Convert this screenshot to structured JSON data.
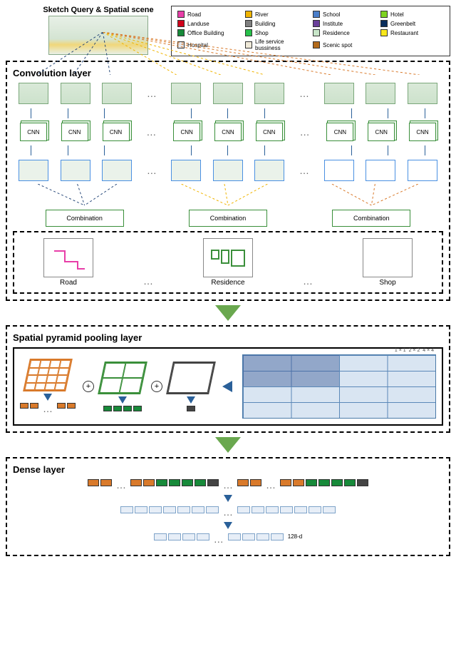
{
  "top": {
    "title": "Sketch Query & Spatial scene"
  },
  "legend": [
    {
      "label": "Road",
      "color": "#e83ea8"
    },
    {
      "label": "River",
      "color": "#f0b400"
    },
    {
      "label": "School",
      "color": "#4a7ec9"
    },
    {
      "label": "Hotel",
      "color": "#7ed321"
    },
    {
      "label": "Landuse",
      "color": "#d0021b"
    },
    {
      "label": "Building",
      "color": "#7f7f7f"
    },
    {
      "label": "Institute",
      "color": "#6a3f9a"
    },
    {
      "label": "Greenbelt",
      "color": "#0a2e5c"
    },
    {
      "label": "Office Building",
      "color": "#178a3a"
    },
    {
      "label": "Shop",
      "color": "#27c04a"
    },
    {
      "label": "Residence",
      "color": "#c8e6c9"
    },
    {
      "label": "Restaurant",
      "color": "#f8e71c"
    },
    {
      "label": "Hospital",
      "color": "#e4e9f0"
    },
    {
      "label": "Life service bussiness",
      "color": "#efe9d8"
    },
    {
      "label": "Scenic spot",
      "color": "#b26a1b"
    }
  ],
  "stages": {
    "conv": {
      "title": "Convolution layer",
      "cnn_label": "CNN",
      "combination_label": "Combination",
      "classes": [
        {
          "name": "Road",
          "color": "#e83ea8"
        },
        {
          "name": "Residence",
          "color": "#3a8f3a"
        },
        {
          "name": "Shop",
          "color": "#27c04a"
        }
      ]
    },
    "spp": {
      "title": "Spatial pyramid pooling layer",
      "grids": [
        {
          "n": 4,
          "border": "#d97a2b",
          "cell": "#d97a2b"
        },
        {
          "n": 2,
          "border": "#3a8f3a",
          "cell": "#3a8f3a"
        },
        {
          "n": 1,
          "border": "#444",
          "cell": "#444"
        }
      ],
      "scales": [
        "1 × 1",
        "2 × 2",
        "4 × 4"
      ]
    },
    "dense": {
      "title": "Dense layer",
      "out_label": "128-d"
    }
  },
  "ellipsis": "…"
}
